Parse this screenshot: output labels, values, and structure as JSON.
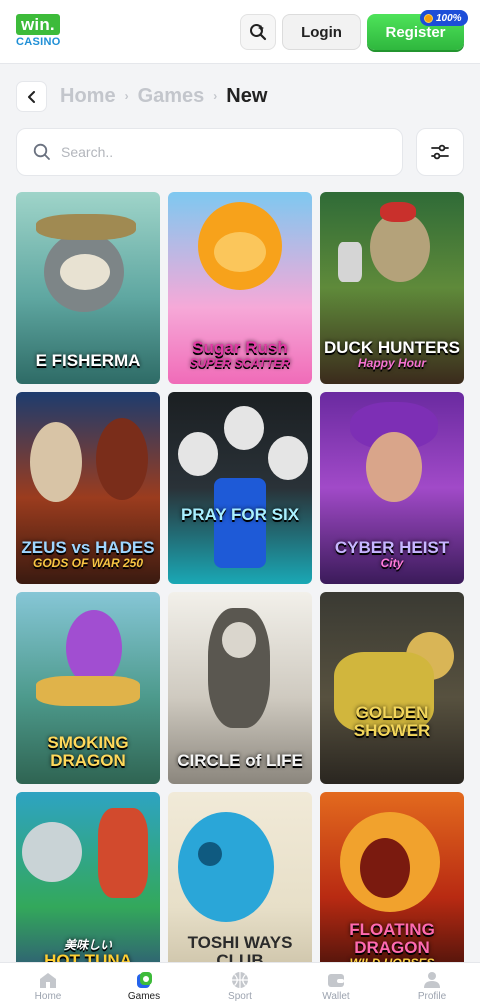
{
  "header": {
    "logo_main": "win.",
    "logo_sub": "CASINO",
    "login_label": "Login",
    "register_label": "Register",
    "bonus_badge": "100%"
  },
  "breadcrumb": {
    "home": "Home",
    "games": "Games",
    "current": "New",
    "separator": "›"
  },
  "search": {
    "placeholder": "Search.."
  },
  "games": [
    {
      "title": "E FISHERMA",
      "subtitle": ""
    },
    {
      "title": "Sugar Rush",
      "subtitle": "SUPER SCATTER"
    },
    {
      "title": "DUCK HUNTERS",
      "subtitle": "Happy Hour"
    },
    {
      "title": "ZEUS vs HADES",
      "subtitle": "GODS OF WAR 250"
    },
    {
      "title": "PRAY FOR SIX",
      "subtitle": ""
    },
    {
      "title": "CYBER HEIST",
      "subtitle": "City"
    },
    {
      "title": "SMOKING DRAGON",
      "subtitle": ""
    },
    {
      "title": "CIRCLE of LIFE",
      "subtitle": ""
    },
    {
      "title": "GOLDEN SHOWER",
      "subtitle": ""
    },
    {
      "title": "HOT TUNA",
      "subtitle": "美味しい"
    },
    {
      "title": "TOSHI WAYS CLUB",
      "subtitle": ""
    },
    {
      "title": "FLOATING DRAGON",
      "subtitle": "WILD HORSES"
    }
  ],
  "bottom_nav": {
    "home": "Home",
    "games": "Games",
    "sport": "Sport",
    "wallet": "Wallet",
    "profile": "Profile"
  },
  "colors": {
    "brand_green": "#3dbb3a",
    "brand_blue": "#1f8fd6",
    "register_green": "#2fb73e",
    "background": "#f3f4f6"
  },
  "icons": [
    "search-icon",
    "back-chevron-icon",
    "filter-sliders-icon",
    "home-icon",
    "games-icon",
    "sport-ball-icon",
    "wallet-icon",
    "profile-icon",
    "coin-icon"
  ]
}
